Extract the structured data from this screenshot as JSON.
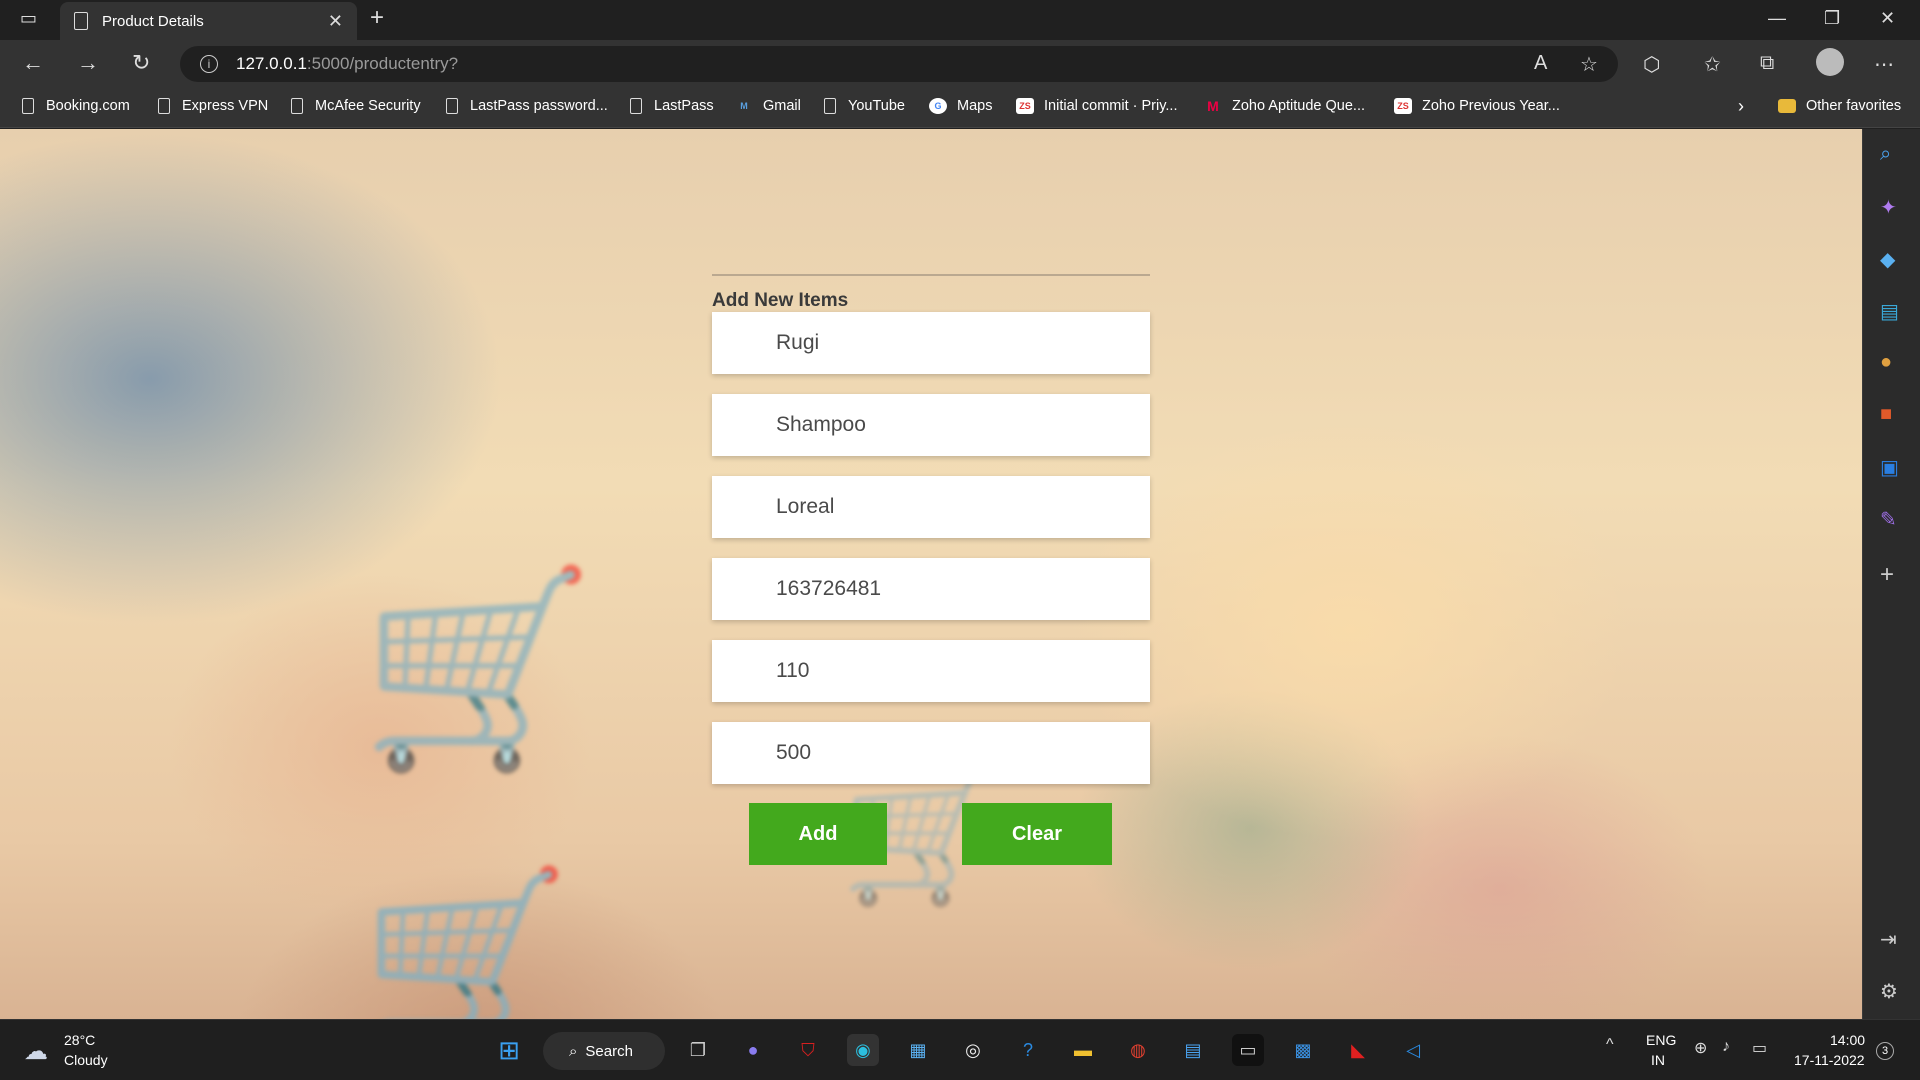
{
  "browser": {
    "tab_title": "Product Details",
    "url_host": "127.0.0.1",
    "url_path": ":5000/productentry?"
  },
  "favorites": [
    {
      "label": "Booking.com"
    },
    {
      "label": "Express VPN"
    },
    {
      "label": "McAfee Security"
    },
    {
      "label": "LastPass password..."
    },
    {
      "label": "LastPass"
    },
    {
      "label": "Gmail"
    },
    {
      "label": "YouTube"
    },
    {
      "label": "Maps"
    },
    {
      "label": "Initial commit · Priy..."
    },
    {
      "label": "Zoho Aptitude Que..."
    },
    {
      "label": "Zoho Previous Year..."
    }
  ],
  "other_favorites": "Other favorites",
  "form": {
    "title": "Add New Items",
    "fields": [
      "Rugi",
      "Shampoo",
      "Loreal",
      "163726481",
      "110",
      "500"
    ],
    "add_label": "Add",
    "clear_label": "Clear"
  },
  "taskbar": {
    "weather_temp": "28°C",
    "weather_desc": "Cloudy",
    "search_label": "Search",
    "lang": "ENG",
    "region": "IN",
    "time": "14:00",
    "date": "17-11-2022",
    "notification_count": "3"
  },
  "colors": {
    "accent_button": "#43a91d",
    "browser_chrome": "#333333"
  }
}
